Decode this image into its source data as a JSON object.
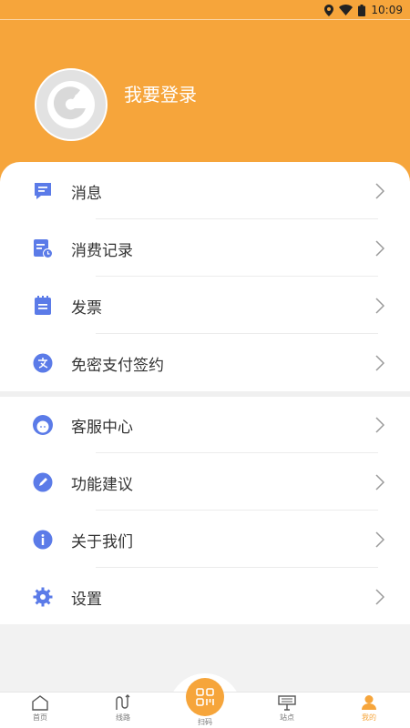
{
  "status_bar": {
    "time": "10:09"
  },
  "profile": {
    "login_text": "我要登录"
  },
  "menu": {
    "items": [
      {
        "label": "消息",
        "icon": "message-icon"
      },
      {
        "label": "消费记录",
        "icon": "records-icon"
      },
      {
        "label": "发票",
        "icon": "invoice-icon"
      },
      {
        "label": "免密支付签约",
        "icon": "password-free-pay-icon"
      },
      {
        "label": "客服中心",
        "icon": "customer-service-icon"
      },
      {
        "label": "功能建议",
        "icon": "suggestion-pencil-icon"
      },
      {
        "label": "关于我们",
        "icon": "info-icon"
      },
      {
        "label": "设置",
        "icon": "gear-icon"
      }
    ]
  },
  "bottom_nav": {
    "items": [
      {
        "label": "首页",
        "icon": "home-icon"
      },
      {
        "label": "线路",
        "icon": "route-icon"
      },
      {
        "label": "扫码",
        "icon": "scan-icon"
      },
      {
        "label": "站点",
        "icon": "station-icon"
      },
      {
        "label": "我的",
        "icon": "profile-icon",
        "active": true
      }
    ]
  },
  "colors": {
    "accent": "#f6a53b",
    "icon_blue": "#5b7be8",
    "background": "#f2f2f2"
  }
}
